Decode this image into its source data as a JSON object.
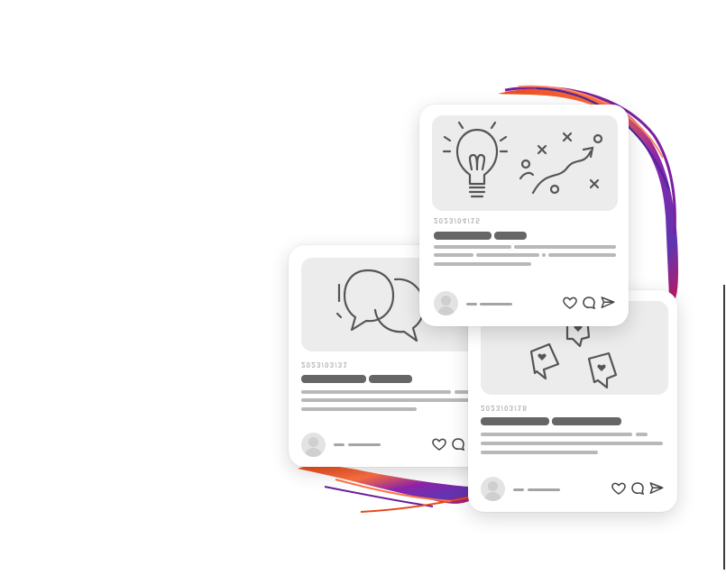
{
  "colors": {
    "background": "#ffffff",
    "card": "#ffffff",
    "image_placeholder": "#ececec",
    "icon_stroke": "#555555",
    "title_bar": "#666666",
    "text_line": "#b8b8b8",
    "brush_stroke": [
      "#e64a19",
      "#ff7043",
      "#8e24aa",
      "#5e35b1",
      "#c2185b"
    ]
  },
  "cards": [
    {
      "id": "discussion",
      "image_icon": "speech-bubbles-icon",
      "date": "2023/03/31",
      "actions": [
        "heart-icon",
        "comment-icon"
      ]
    },
    {
      "id": "strategy",
      "image_icon": "lightbulb-icon",
      "secondary_icon": "strategy-diagram-icon",
      "date": "2023/04/15",
      "actions": [
        "heart-icon",
        "comment-icon",
        "send-icon"
      ]
    },
    {
      "id": "social",
      "image_icon": "heart-notifications-icon",
      "date": "2023/03/18",
      "actions": [
        "heart-icon",
        "comment-icon",
        "send-icon"
      ]
    }
  ]
}
